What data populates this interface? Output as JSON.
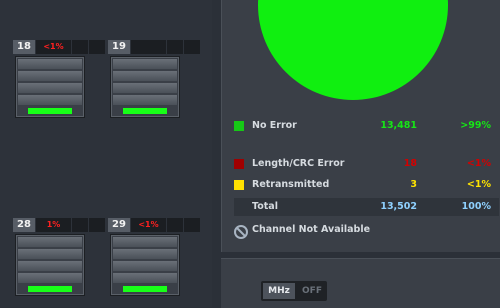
{
  "colors": {
    "no_error": "#16e616",
    "crc_error": "#d40000",
    "retransmitted": "#ffe400",
    "total": "#8fd1ff"
  },
  "channels": [
    {
      "number": "18",
      "pct": "<1%",
      "meter": "green"
    },
    {
      "number": "19",
      "pct": "",
      "meter": "green"
    },
    {
      "number": "28",
      "pct": "1%",
      "meter": "green"
    },
    {
      "number": "29",
      "pct": "<1%",
      "meter": "green"
    }
  ],
  "legend": {
    "no_error": {
      "label": "No Error",
      "value": "13,481",
      "pct": ">99%"
    },
    "crc_error": {
      "label": "Length/CRC Error",
      "value": "18",
      "pct": "<1%"
    },
    "retransmitted": {
      "label": "Retransmitted",
      "value": "3",
      "pct": "<1%"
    },
    "total": {
      "label": "Total",
      "value": "13,502",
      "pct": "100%"
    },
    "not_available": "Channel Not Available"
  },
  "toggle": {
    "on_label": "MHz",
    "off_label": "OFF"
  }
}
